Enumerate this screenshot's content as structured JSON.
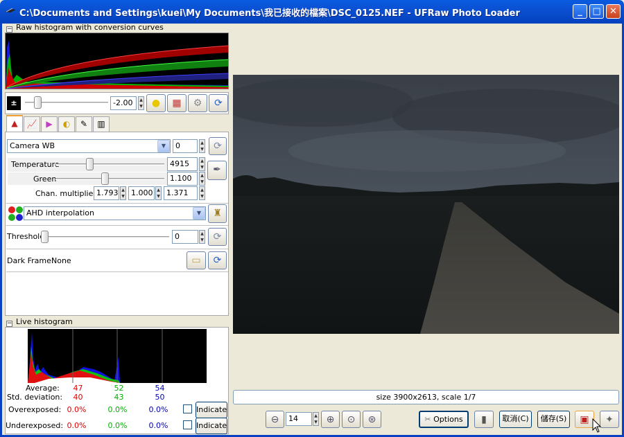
{
  "window": {
    "title": "C:\\Documents and Settings\\kuei\\My Documents\\我已接收的檔案\\DSC_0125.NEF - UFRaw Photo Loader",
    "minimize": "_",
    "maximize": "□",
    "close": "✕"
  },
  "raw_histogram": {
    "label": "Raw histogram with conversion curves",
    "toggle": "−"
  },
  "exposure": {
    "value": "-2.00",
    "slider_fraction": 0.15
  },
  "icons": {
    "exposure": "exposure-icon",
    "bulb": "light-bulb-icon",
    "color": "color-grid-icon",
    "gear": "gears-icon",
    "refresh": "refresh-icon"
  },
  "tabs": [
    "white-balance-tab",
    "curve-tab",
    "color-tab",
    "lightness-tab",
    "crop-tab",
    "exif-tab"
  ],
  "white_balance": {
    "preset": "Camera WB",
    "fine_tune": "0",
    "temperature_label": "Temperature",
    "temperature": "4915",
    "temperature_fraction": 0.31,
    "green_label": "Green",
    "green": "1.100",
    "green_fraction": 0.45,
    "chan_label": "Chan. multipliers:",
    "chan": [
      "1.793",
      "1.000",
      "1.371"
    ]
  },
  "interpolation": {
    "value": "AHD interpolation"
  },
  "denoise": {
    "label": "Threshold",
    "value": "0"
  },
  "dark_frame": {
    "label": "Dark Frame:",
    "value": "None"
  },
  "live_histogram": {
    "label": "Live histogram",
    "toggle": "−"
  },
  "stats": {
    "average_label": "Average:",
    "average": [
      "47",
      "52",
      "54"
    ],
    "std_label": "Std. deviation:",
    "std": [
      "40",
      "43",
      "50"
    ],
    "over_label": "Overexposed:",
    "over": [
      "0.0%",
      "0.0%",
      "0.0%"
    ],
    "under_label": "Underexposed:",
    "under": [
      "0.0%",
      "0.0%",
      "0.0%"
    ],
    "indicate": "Indicate"
  },
  "colors": {
    "red": "#e00000",
    "green": "#00b000",
    "blue": "#0000c0"
  },
  "status": {
    "text": "size 3900x2613, scale 1/7"
  },
  "zoom": {
    "value": "14"
  },
  "buttons": {
    "options": "Options",
    "cancel": "取消(C)",
    "save": "儲存(S)"
  }
}
